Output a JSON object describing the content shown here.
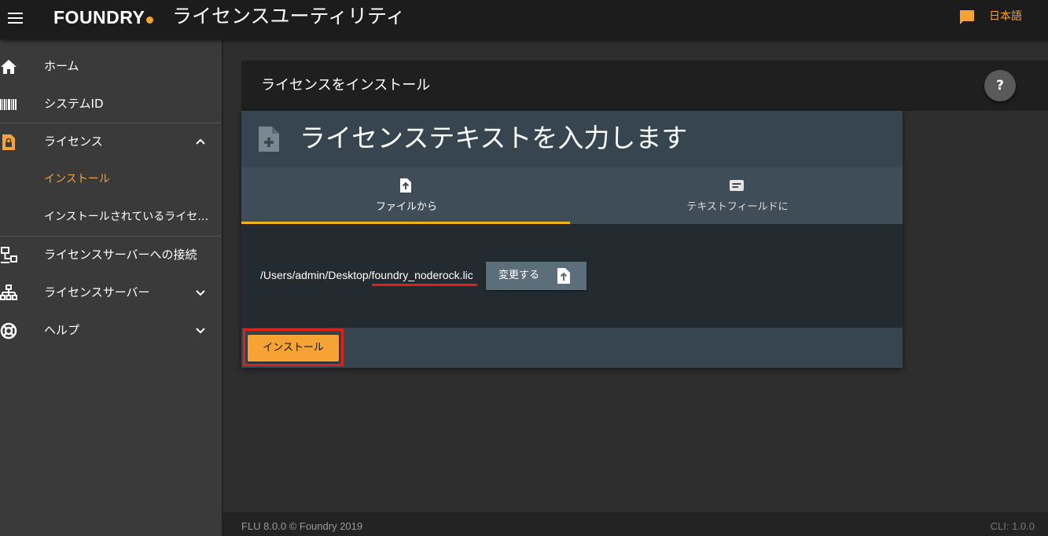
{
  "header": {
    "brand": "FOUNDRY",
    "title": "ライセンスユーティリティ",
    "language": "日本語",
    "accent_color": "#f7a234"
  },
  "sidebar": {
    "items": [
      {
        "label": "ホーム",
        "icon": "home-icon"
      },
      {
        "label": "システムID",
        "icon": "barcode-icon"
      },
      {
        "label": "ライセンス",
        "icon": "license-lock-icon",
        "expanded": true
      },
      {
        "label": "インストール",
        "active": true
      },
      {
        "label": "インストールされているライセ…"
      },
      {
        "label": "ライセンスサーバーへの接続",
        "icon": "network-computer-icon"
      },
      {
        "label": "ライセンスサーバー",
        "icon": "server-tree-icon",
        "expanded": false
      },
      {
        "label": "ヘルプ",
        "icon": "lifebuoy-icon",
        "expanded": false
      }
    ]
  },
  "panel": {
    "title": "ライセンスをインストール",
    "help_label": "?"
  },
  "card": {
    "title": "ライセンステキストを入力します",
    "tabs": [
      {
        "label": "ファイルから",
        "icon": "file-upload-icon",
        "selected": true
      },
      {
        "label": "テキストフィールドに",
        "icon": "text-field-icon",
        "selected": false
      }
    ],
    "file_path": "/Users/admin/Desktop/foundry_noderock.lic",
    "change_button": "変更する",
    "install_button": "インストール"
  },
  "footer": {
    "left": "FLU 8.0.0 © Foundry 2019",
    "right": "CLI: 1.0.0"
  }
}
